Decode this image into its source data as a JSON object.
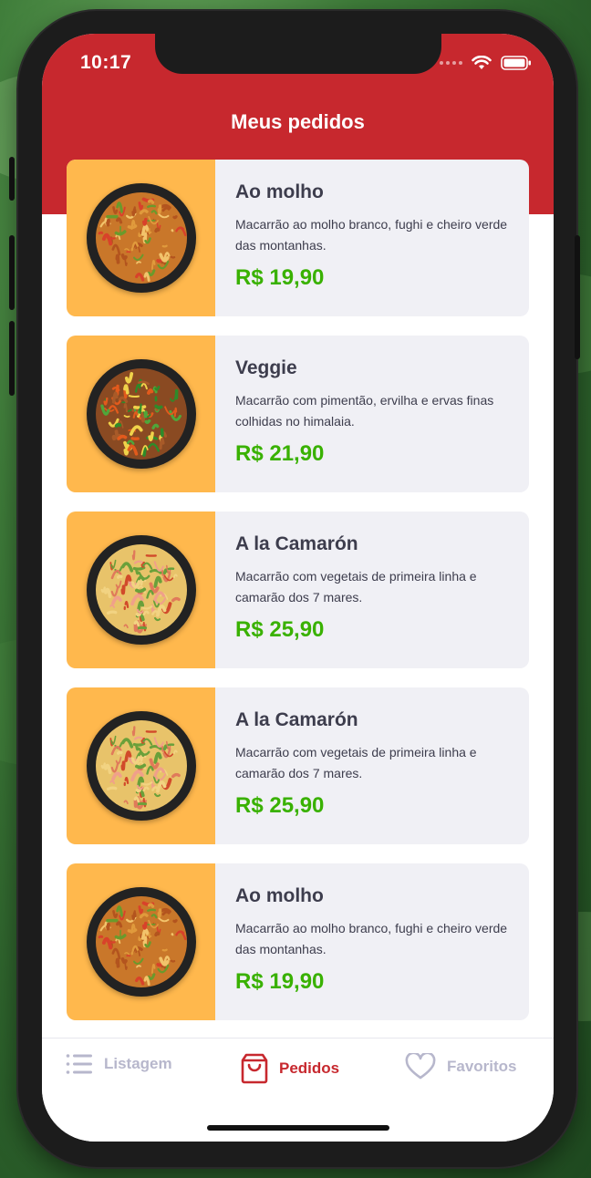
{
  "status": {
    "time": "10:17"
  },
  "header": {
    "title": "Meus pedidos"
  },
  "orders": [
    {
      "name": "Ao molho",
      "description": "Macarrão ao molho branco, fughi e cheiro verde das montanhas.",
      "price": "R$ 19,90",
      "image": "pasta-molho"
    },
    {
      "name": "Veggie",
      "description": "Macarrão com pimentão, ervilha e ervas finas colhidas no himalaia.",
      "price": "R$ 21,90",
      "image": "pasta-veggie"
    },
    {
      "name": "A la Camarón",
      "description": "Macarrão com vegetais de primeira linha e camarão dos 7 mares.",
      "price": "R$ 25,90",
      "image": "pasta-camarao"
    },
    {
      "name": "A la Camarón",
      "description": "Macarrão com vegetais de primeira linha e camarão dos 7 mares.",
      "price": "R$ 25,90",
      "image": "pasta-camarao"
    },
    {
      "name": "Ao molho",
      "description": "Macarrão ao molho branco, fughi e cheiro verde das montanhas.",
      "price": "R$ 19,90",
      "image": "pasta-molho"
    }
  ],
  "tabs": [
    {
      "label": "Listagem",
      "icon": "list-icon",
      "active": false
    },
    {
      "label": "Pedidos",
      "icon": "shopping-bag-icon",
      "active": true
    },
    {
      "label": "Favoritos",
      "icon": "heart-icon",
      "active": false
    }
  ],
  "colors": {
    "primary": "#c7282e",
    "price": "#39b100",
    "image_bg": "#ffb84d",
    "card_bg": "#f0f0f5",
    "text": "#3d3d4d",
    "tab_inactive": "#b7b7cc"
  }
}
